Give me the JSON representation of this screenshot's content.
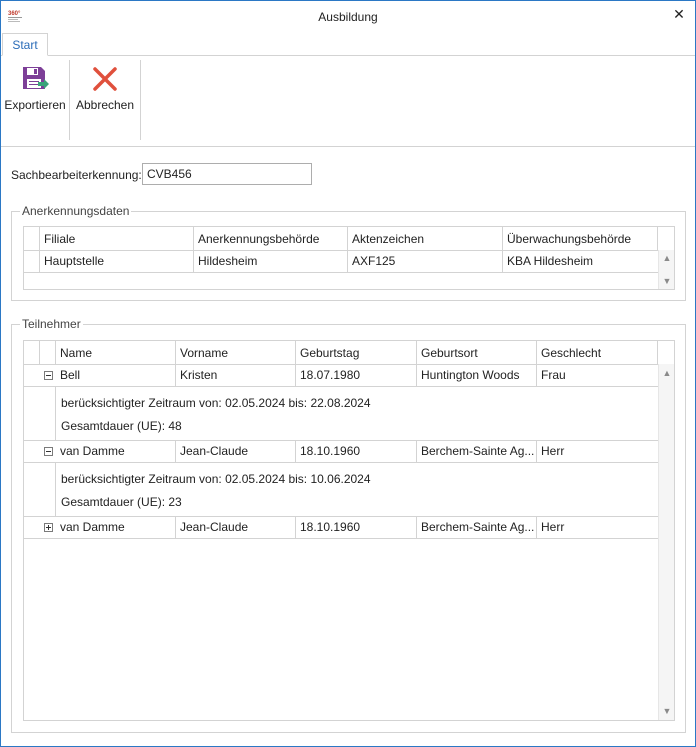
{
  "window": {
    "title": "Ausbildung",
    "close_label": "✕"
  },
  "ribbon": {
    "tabs": [
      {
        "label": "Start"
      }
    ],
    "buttons": [
      {
        "label": "Exportieren",
        "icon": "save-icon"
      },
      {
        "label": "Abbrechen",
        "icon": "cancel-icon"
      }
    ]
  },
  "form": {
    "sachbearbeiter_label": "Sachbearbeiterkennung:",
    "sachbearbeiter_value": "CVB456"
  },
  "anerkennung": {
    "title": "Anerkennungsdaten",
    "columns": [
      "Filiale",
      "Anerkennungsbehörde",
      "Aktenzeichen",
      "Überwachungsbehörde"
    ],
    "rows": [
      [
        "Hauptstelle",
        "Hildesheim",
        "AXF125",
        "KBA Hildesheim"
      ]
    ]
  },
  "teilnehmer": {
    "title": "Teilnehmer",
    "columns": [
      "Name",
      "Vorname",
      "Geburtstag",
      "Geburtsort",
      "Geschlecht"
    ],
    "rows": [
      {
        "cells": [
          "Bell",
          "Kristen",
          "18.07.1980",
          "Huntington Woods",
          "Frau"
        ],
        "expanded": true,
        "details": [
          "berücksichtigter Zeitraum von: 02.05.2024 bis: 22.08.2024",
          "Gesamtdauer (UE): 48"
        ]
      },
      {
        "cells": [
          "van Damme",
          "Jean-Claude",
          "18.10.1960",
          "Berchem-Sainte Ag...",
          "Herr"
        ],
        "expanded": true,
        "details": [
          "berücksichtigter Zeitraum von: 02.05.2024 bis: 10.06.2024",
          "Gesamtdauer (UE): 23"
        ]
      },
      {
        "cells": [
          "van Damme",
          "Jean-Claude",
          "18.10.1960",
          "Berchem-Sainte Ag...",
          "Herr"
        ],
        "expanded": false,
        "details": []
      }
    ]
  },
  "colors": {
    "accent": "#2b6cb8",
    "save_icon": "#7d3f98",
    "cancel_icon": "#e0503c",
    "border": "#d3d3d3"
  }
}
